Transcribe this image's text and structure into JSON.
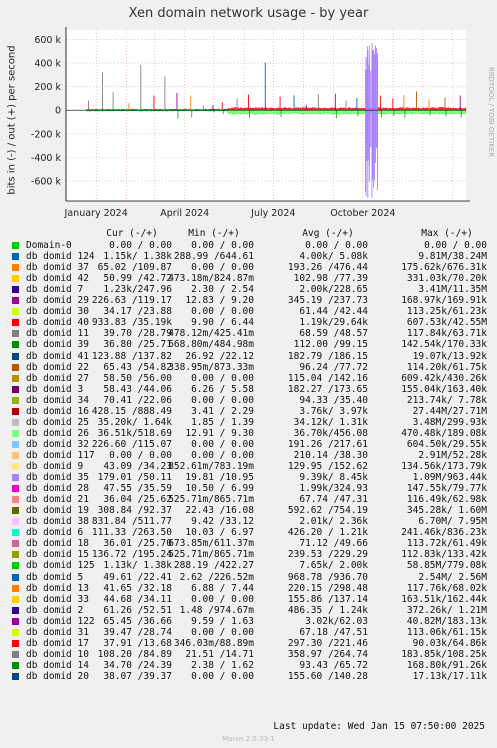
{
  "chart_data": {
    "type": "area",
    "title": "Xen domain network usage - by year",
    "ylabel": "bits in (-) / out (+) per second",
    "side_label": "RRDTOOL / TOBI OETIKER",
    "ylim": [
      -770000,
      680000
    ],
    "yticks": [
      {
        "value": 600000,
        "label": "600 k"
      },
      {
        "value": 400000,
        "label": "400 k"
      },
      {
        "value": 200000,
        "label": "200 k"
      },
      {
        "value": 0,
        "label": "0"
      },
      {
        "value": -200000,
        "label": "-200 k"
      },
      {
        "value": -400000,
        "label": "-400 k"
      },
      {
        "value": -600000,
        "label": "-600 k"
      }
    ],
    "xrange": [
      "2023-12-01",
      "2025-01-15"
    ],
    "xticks": [
      {
        "date": "2024-01-01",
        "label": "January 2024"
      },
      {
        "date": "2024-04-01",
        "label": "April 2024"
      },
      {
        "date": "2024-07-01",
        "label": "July 2024"
      },
      {
        "date": "2024-10-01",
        "label": "October 2024"
      }
    ],
    "grid": true,
    "legend": {
      "headers": [
        "Cur (-/+)",
        "Min (-/+)",
        "Avg (-/+)",
        "Max (-/+)"
      ],
      "rows": [
        {
          "name": "Domain-0",
          "color": "#00cc00",
          "cur": "0.00 / 0.00",
          "min": "0.00 / 0.00",
          "avg": "0.00 / 0.00",
          "max": "0.00 / 0.00"
        },
        {
          "name": "db domid 124",
          "color": "#0066b3",
          "cur": "1.15k/ 1.38k",
          "min": "288.99 /644.61",
          "avg": "4.00k/ 5.08k",
          "max": "9.81M/38.24M"
        },
        {
          "name": "db domid 37",
          "color": "#ff8000",
          "cur": "65.02 /109.87",
          "min": "0.00 / 0.00",
          "avg": "193.26 /476.44",
          "max": "175.62k/676.31k"
        },
        {
          "name": "db domid 42",
          "color": "#ffcc00",
          "cur": "50.99 /42.72",
          "min": "473.18m/824.87m",
          "avg": "102.98 /77.39",
          "max": "331.03k/70.20k"
        },
        {
          "name": "db domid 7",
          "color": "#330099",
          "cur": "1.23k/247.96",
          "min": "2.30 / 2.54",
          "avg": "2.00k/228.65",
          "max": "3.41M/11.35M"
        },
        {
          "name": "db domid 29",
          "color": "#990099",
          "cur": "226.63 /119.17",
          "min": "12.83 / 9.20",
          "avg": "345.19 /237.73",
          "max": "168.97k/169.91k"
        },
        {
          "name": "db domid 30",
          "color": "#ccff00",
          "cur": "34.17 /23.88",
          "min": "0.00 / 0.00",
          "avg": "61.44 /42.44",
          "max": "113.25k/61.23k"
        },
        {
          "name": "db domid 40",
          "color": "#ff0000",
          "cur": "933.83 /35.19k",
          "min": "9.90 / 6.44",
          "avg": "1.19k/29.64k",
          "max": "607.53k/42.55M"
        },
        {
          "name": "db domid 11",
          "color": "#808080",
          "cur": "39.70 /28.79",
          "min": "478.12m/425.41m",
          "avg": "68.59 /48.57",
          "max": "117.84k/63.71k"
        },
        {
          "name": "db domid 39",
          "color": "#008f00",
          "cur": "36.80 /25.71",
          "min": "668.80m/484.98m",
          "avg": "112.00 /99.15",
          "max": "142.54k/170.33k"
        },
        {
          "name": "db domid 41",
          "color": "#00487d",
          "cur": "123.88 /137.82",
          "min": "26.92 /22.12",
          "avg": "182.79 /186.15",
          "max": "19.07k/13.92k"
        },
        {
          "name": "db domid 22",
          "color": "#b35a00",
          "cur": "65.43 /54.82",
          "min": "338.95m/873.33m",
          "avg": "96.24 /77.72",
          "max": "114.20k/61.75k"
        },
        {
          "name": "db domid 27",
          "color": "#b38f00",
          "cur": "58.50 /56.00",
          "min": "0.00 / 0.00",
          "avg": "115.04 /142.16",
          "max": "609.42k/430.26k"
        },
        {
          "name": "db domid 3",
          "color": "#6b006b",
          "cur": "58.43 /44.06",
          "min": "6.26 / 5.58",
          "avg": "182.27 /173.65",
          "max": "155.04k/163.40k"
        },
        {
          "name": "db domid 34",
          "color": "#8fb300",
          "cur": "70.41 /22.06",
          "min": "0.00 / 0.00",
          "avg": "94.33 /35.40",
          "max": "213.74k/ 7.78k"
        },
        {
          "name": "db domid 16",
          "color": "#b30000",
          "cur": "428.15 /888.49",
          "min": "3.41 / 2.29",
          "avg": "3.76k/ 3.97k",
          "max": "27.44M/27.71M"
        },
        {
          "name": "db domid 25",
          "color": "#bebebe",
          "cur": "35.20k/ 1.64k",
          "min": "1.85 / 1.39",
          "avg": "34.12k/ 1.31k",
          "max": "3.48M/299.93k"
        },
        {
          "name": "db domid 26",
          "color": "#80ff80",
          "cur": "36.51k/518.69",
          "min": "12.91 / 9.30",
          "avg": "36.70k/456.08",
          "max": "470.48k/189.08k"
        },
        {
          "name": "db domid 32",
          "color": "#80c9ff",
          "cur": "226.60 /115.07",
          "min": "0.00 / 0.00",
          "avg": "191.26 /217.61",
          "max": "604.50k/29.55k"
        },
        {
          "name": "db domid 117",
          "color": "#ffc080",
          "cur": "0.00 / 0.00",
          "min": "0.00 / 0.00",
          "avg": "210.14 /38.30",
          "max": "2.91M/52.28k"
        },
        {
          "name": "db domid 9",
          "color": "#ffe680",
          "cur": "43.09 /34.23",
          "min": "852.61m/783.19m",
          "avg": "129.95 /152.62",
          "max": "134.56k/173.79k"
        },
        {
          "name": "db domid 35",
          "color": "#aa80ff",
          "cur": "179.01 /50.11",
          "min": "19.81 /10.95",
          "avg": "9.39k/ 8.45k",
          "max": "1.09M/963.44k"
        },
        {
          "name": "db domid 28",
          "color": "#ee00cc",
          "cur": "47.55 /35.59",
          "min": "10.50 / 6.99",
          "avg": "1.99k/324.93",
          "max": "147.55k/79.77k"
        },
        {
          "name": "db domid 21",
          "color": "#ff8080",
          "cur": "36.04 /25.62",
          "min": "525.71m/865.71m",
          "avg": "67.74 /47.31",
          "max": "116.49k/62.98k"
        },
        {
          "name": "db domid 19",
          "color": "#666600",
          "cur": "308.84 /92.37",
          "min": "22.43 /16.08",
          "avg": "592.62 /754.19",
          "max": "345.28k/ 1.60M"
        },
        {
          "name": "db domid 38",
          "color": "#ffbfff",
          "cur": "831.84 /511.77",
          "min": "9.42 /33.12",
          "avg": "2.01k/ 2.36k",
          "max": "6.70M/ 7.95M"
        },
        {
          "name": "db domid 6",
          "color": "#00ffcc",
          "cur": "111.33 /263.50",
          "min": "10.03 / 6.97",
          "avg": "426.20 / 1.21k",
          "max": "241.46k/836.23k"
        },
        {
          "name": "db domid 18",
          "color": "#cc6699",
          "cur": "36.01 /25.70",
          "min": "673.85m/611.37m",
          "avg": "71.12 /49.66",
          "max": "113.72k/61.49k"
        },
        {
          "name": "db domid 15",
          "color": "#999900",
          "cur": "136.72 /195.24",
          "min": "525.71m/865.71m",
          "avg": "239.53 /229.29",
          "max": "112.83k/133.42k"
        },
        {
          "name": "db domid 125",
          "color": "#00cc00",
          "cur": "1.13k/ 1.38k",
          "min": "288.19 /422.27",
          "avg": "7.65k/ 2.00k",
          "max": "58.85M/779.08k"
        },
        {
          "name": "db domid 5",
          "color": "#0066b3",
          "cur": "49.61 /22.41",
          "min": "2.62 /226.52m",
          "avg": "968.78 /936.70",
          "max": "2.54M/ 2.56M"
        },
        {
          "name": "db domid 13",
          "color": "#ff8000",
          "cur": "41.65 /32.18",
          "min": "6.88 / 7.44",
          "avg": "220.15 /298.48",
          "max": "117.76k/68.02k"
        },
        {
          "name": "db domid 33",
          "color": "#ffcc00",
          "cur": "44.68 /34.11",
          "min": "0.00 / 0.00",
          "avg": "155.86 /137.14",
          "max": "163.51k/162.44k"
        },
        {
          "name": "db domid 2",
          "color": "#330099",
          "cur": "61.26 /52.51",
          "min": "1.48 /974.67m",
          "avg": "486.35 / 1.24k",
          "max": "372.26k/ 1.21M"
        },
        {
          "name": "db domid 122",
          "color": "#990099",
          "cur": "65.45 /36.66",
          "min": "9.59 / 1.63",
          "avg": "3.02k/62.03",
          "max": "40.82M/183.13k"
        },
        {
          "name": "db domid 31",
          "color": "#ccff00",
          "cur": "39.47 /28.74",
          "min": "0.00 / 0.00",
          "avg": "67.18 /47.51",
          "max": "113.06k/61.15k"
        },
        {
          "name": "db domid 17",
          "color": "#ff0000",
          "cur": "37.91 /13.68",
          "min": "346.03m/88.89m",
          "avg": "297.30 /221.46",
          "max": "90.03k/64.86k"
        },
        {
          "name": "db domid 10",
          "color": "#808080",
          "cur": "108.20 /84.89",
          "min": "21.51 /14.71",
          "avg": "358.97 /264.74",
          "max": "183.85k/108.25k"
        },
        {
          "name": "db domid 14",
          "color": "#008f00",
          "cur": "34.70 /24.39",
          "min": "2.38 / 1.62",
          "avg": "93.43 /65.72",
          "max": "168.80k/91.26k"
        },
        {
          "name": "db domid 20",
          "color": "#00487d",
          "cur": "38.07 /39.37",
          "min": "0.00 / 0.00",
          "avg": "155.60 /140.28",
          "max": "17.13k/17.11k"
        }
      ]
    }
  },
  "last_update": "Last update: Wed Jan 15 07:50:00 2025",
  "footer": "Munin 2.0.33-1"
}
